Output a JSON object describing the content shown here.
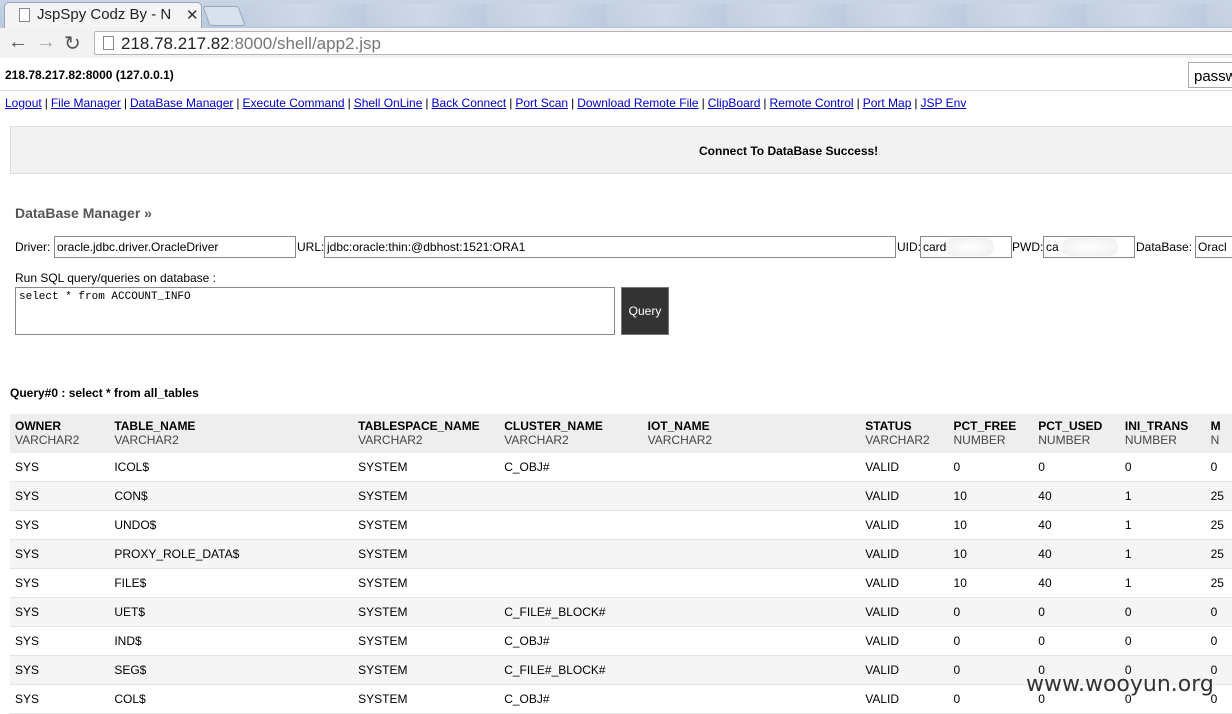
{
  "browser": {
    "tab_title": "JspSpy Codz By - N",
    "url_host": "218.78.217.82",
    "url_rest": ":8000/shell/app2.jsp"
  },
  "shell": {
    "host_line": "218.78.217.82:8000 (127.0.0.1)",
    "password_field": "passw",
    "menu": [
      "Logout",
      "File Manager",
      "DataBase Manager",
      "Execute Command",
      "Shell OnLine",
      "Back Connect",
      "Port Scan",
      "Download Remote File",
      "ClipBoard",
      "Remote Control",
      "Port Map",
      "JSP Env"
    ],
    "message": "Connect To DataBase Success!"
  },
  "db": {
    "title": "DataBase Manager »",
    "driver_label": "Driver:",
    "driver_value": "oracle.jdbc.driver.OracleDriver",
    "url_label": "URL:",
    "url_value": "jdbc:oracle:thin:@dbhost:1521:ORA1",
    "uid_label": "UID:",
    "uid_value": "card",
    "pwd_label": "PWD:",
    "pwd_value": "ca",
    "database_label": "DataBase:",
    "database_value": "Oracl",
    "sql_label": "Run SQL query/queries on database :",
    "sql_value": "select * from ACCOUNT_INFO",
    "query_button": "Query"
  },
  "result": {
    "title": "Query#0 : select * from all_tables",
    "columns": [
      {
        "name": "OWNER",
        "type": "VARCHAR2"
      },
      {
        "name": "TABLE_NAME",
        "type": "VARCHAR2"
      },
      {
        "name": "TABLESPACE_NAME",
        "type": "VARCHAR2"
      },
      {
        "name": "CLUSTER_NAME",
        "type": "VARCHAR2"
      },
      {
        "name": "IOT_NAME",
        "type": "VARCHAR2"
      },
      {
        "name": "STATUS",
        "type": "VARCHAR2"
      },
      {
        "name": "PCT_FREE",
        "type": "NUMBER"
      },
      {
        "name": "PCT_USED",
        "type": "NUMBER"
      },
      {
        "name": "INI_TRANS",
        "type": "NUMBER"
      },
      {
        "name": "M",
        "type": "N"
      }
    ],
    "rows": [
      [
        "SYS",
        "ICOL$",
        "SYSTEM",
        "C_OBJ#",
        "",
        "VALID",
        "0",
        "0",
        "0",
        "0"
      ],
      [
        "SYS",
        "CON$",
        "SYSTEM",
        "",
        "",
        "VALID",
        "10",
        "40",
        "1",
        "25"
      ],
      [
        "SYS",
        "UNDO$",
        "SYSTEM",
        "",
        "",
        "VALID",
        "10",
        "40",
        "1",
        "25"
      ],
      [
        "SYS",
        "PROXY_ROLE_DATA$",
        "SYSTEM",
        "",
        "",
        "VALID",
        "10",
        "40",
        "1",
        "25"
      ],
      [
        "SYS",
        "FILE$",
        "SYSTEM",
        "",
        "",
        "VALID",
        "10",
        "40",
        "1",
        "25"
      ],
      [
        "SYS",
        "UET$",
        "SYSTEM",
        "C_FILE#_BLOCK#",
        "",
        "VALID",
        "0",
        "0",
        "0",
        "0"
      ],
      [
        "SYS",
        "IND$",
        "SYSTEM",
        "C_OBJ#",
        "",
        "VALID",
        "0",
        "0",
        "0",
        "0"
      ],
      [
        "SYS",
        "SEG$",
        "SYSTEM",
        "C_FILE#_BLOCK#",
        "",
        "VALID",
        "0",
        "0",
        "0",
        "0"
      ],
      [
        "SYS",
        "COL$",
        "SYSTEM",
        "C_OBJ#",
        "",
        "VALID",
        "0",
        "0",
        "0",
        "0"
      ]
    ]
  },
  "watermark": "www.wooyun.org"
}
